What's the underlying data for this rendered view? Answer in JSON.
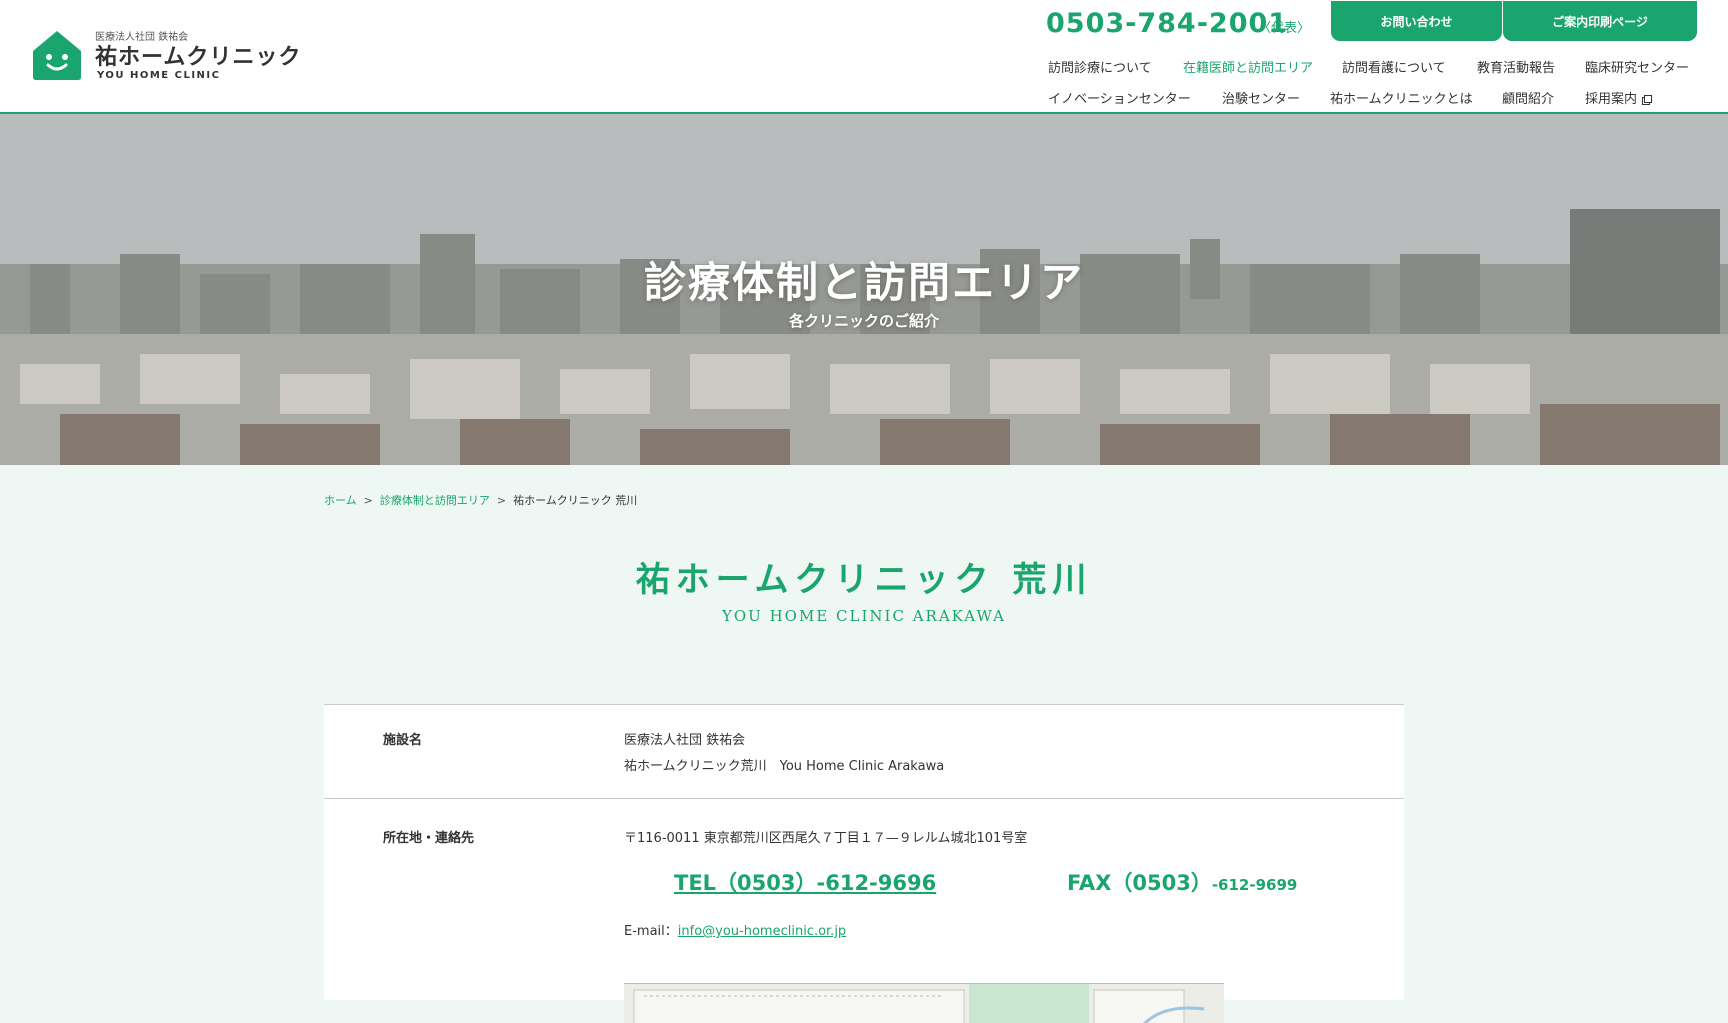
{
  "header": {
    "logo_org": "医療法人社団 鉄祐会",
    "logo_name": "祐ホームクリニック",
    "logo_en": "YOU HOME CLINIC",
    "phone": "0503-784-2001",
    "phone_note": "〈代表〉",
    "contact_button": "お問い合わせ",
    "print_button": "ご案内印刷ページ"
  },
  "nav": {
    "row1": [
      "訪問診療について",
      "在籍医師と訪問エリア",
      "訪問看護について",
      "教育活動報告",
      "臨床研究センター"
    ],
    "row2": [
      "イノベーションセンター",
      "治験センター",
      "祐ホームクリニックとは",
      "顧問紹介",
      "採用案内"
    ],
    "active": "在籍医師と訪問エリア"
  },
  "hero": {
    "title": "診療体制と訪問エリア",
    "subtitle": "各クリニックのご紹介"
  },
  "breadcrumb": {
    "home": "ホーム",
    "parent": "診療体制と訪問エリア",
    "current": "祐ホームクリニック 荒川",
    "separator": ">"
  },
  "clinic": {
    "title": "祐ホームクリニック 荒川",
    "title_en": "YOU HOME CLINIC ARAKAWA"
  },
  "info": {
    "facility_label": "施設名",
    "facility_line1": "医療法人社団 鉄祐会",
    "facility_line2": "祐ホームクリニック荒川　You Home Clinic Arakawa",
    "contact_label": "所在地・連絡先",
    "address": "〒116-0011 東京都荒川区西尾久７丁目１７—９レルム城北101号室",
    "tel": "TEL（0503）-612-9696",
    "fax_main": "FAX（0503）",
    "fax_tail": "-612-9699",
    "email_label": "E-mail：",
    "email": "info@you-homeclinic.or.jp"
  },
  "colors": {
    "brand_green": "#1aa56e",
    "page_background": "#eef7f3"
  }
}
